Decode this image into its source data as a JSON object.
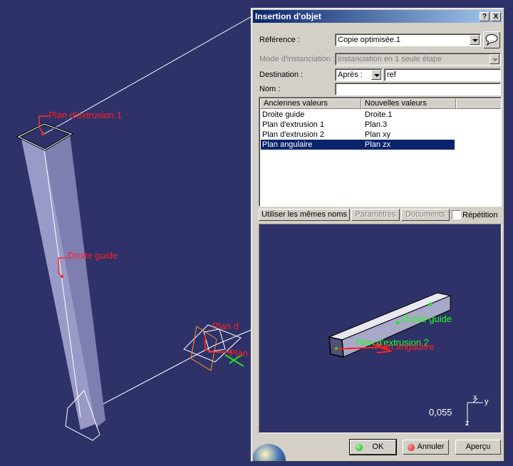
{
  "viewport": {
    "labels": {
      "plan_extrusion_1": "Plan d'extrusion 1",
      "droite_guide": "Droite guide",
      "plan_d_partial": "Plan d",
      "plan_partial": "Plan"
    }
  },
  "dialog": {
    "title": "Insertion d'objet",
    "help_label": "?",
    "close_label": "X",
    "reference": {
      "label": "Référence :",
      "value": "Copie optimisée.1"
    },
    "mode": {
      "label": "Mode d'instanciation :",
      "value": "Instanciation en 1 seule étape"
    },
    "destination": {
      "label": "Destination :",
      "select_value": "Après :",
      "input_value": "ref"
    },
    "nom": {
      "label": "Nom :",
      "value": ""
    },
    "table": {
      "headers": [
        "Anciennes valeurs",
        "Nouvelles valeurs"
      ],
      "rows": [
        {
          "old": "Droite guide",
          "new": "Droite.1"
        },
        {
          "old": "Plan d'extrusion 1",
          "new": "Plan.3"
        },
        {
          "old": "Plan d'extrusion 2",
          "new": "Plan xy"
        },
        {
          "old": "Plan angulaire",
          "new": "Plan zx"
        }
      ],
      "selected_index": 3
    },
    "buttons": {
      "same_names": "Utiliser les mêmes noms",
      "parameters": "Paramètres",
      "documents": "Documents",
      "repetition": "Répétition"
    },
    "preview": {
      "labels": {
        "droite_guide": "Droite guide",
        "plan_extrusion_2": "Plan d'extrusion 2",
        "plan_angulaire": "Plan angulaire"
      },
      "scale": "0,055",
      "axis_x": "x",
      "axis_y": "y",
      "axis_z": "z"
    },
    "footer": {
      "ok": "OK",
      "cancel": "Annuler",
      "preview": "Aperçu"
    }
  },
  "colors": {
    "background": "#2e3268",
    "selection": "#0a246a",
    "label_red": "#ff2020",
    "label_green": "#20ff20"
  }
}
